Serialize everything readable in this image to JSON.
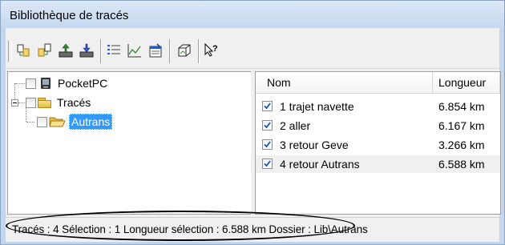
{
  "window": {
    "title": "Bibliothèque de tracés"
  },
  "toolbar": {
    "buttons": [
      {
        "icon": "copy-folder-icon"
      },
      {
        "icon": "copy-track-icon"
      },
      {
        "icon": "upload-icon"
      },
      {
        "icon": "download-icon"
      },
      {
        "icon": "list-icon"
      },
      {
        "icon": "chart-icon"
      },
      {
        "icon": "properties-icon"
      },
      {
        "icon": "3d-view-icon"
      },
      {
        "icon": "help-pointer-icon"
      }
    ]
  },
  "tree": {
    "nodes": [
      {
        "label": "PocketPC",
        "icon": "device-icon"
      },
      {
        "label": "Tracés",
        "icon": "folder-icon"
      },
      {
        "label": "Autrans",
        "icon": "folder-open-icon",
        "selected": true
      }
    ]
  },
  "list": {
    "columns": {
      "name": "Nom",
      "length": "Longueur"
    },
    "rows": [
      {
        "name": "1 trajet navette",
        "length": "6.854 km",
        "checked": true
      },
      {
        "name": "2 aller",
        "length": "6.167 km",
        "checked": true
      },
      {
        "name": "3 retour Geve",
        "length": "3.266 km",
        "checked": true
      },
      {
        "name": "4 retour Autrans",
        "length": "6.588 km",
        "checked": true
      }
    ]
  },
  "status": {
    "text": "Tracés : 4 Sélection : 1 Longueur sélection : 6.588 km Dossier : Lib\\Autrans"
  },
  "colors": {
    "selection": "#3399ff",
    "check": "#1a4fa8",
    "titlebar": "#c5d8ef"
  }
}
